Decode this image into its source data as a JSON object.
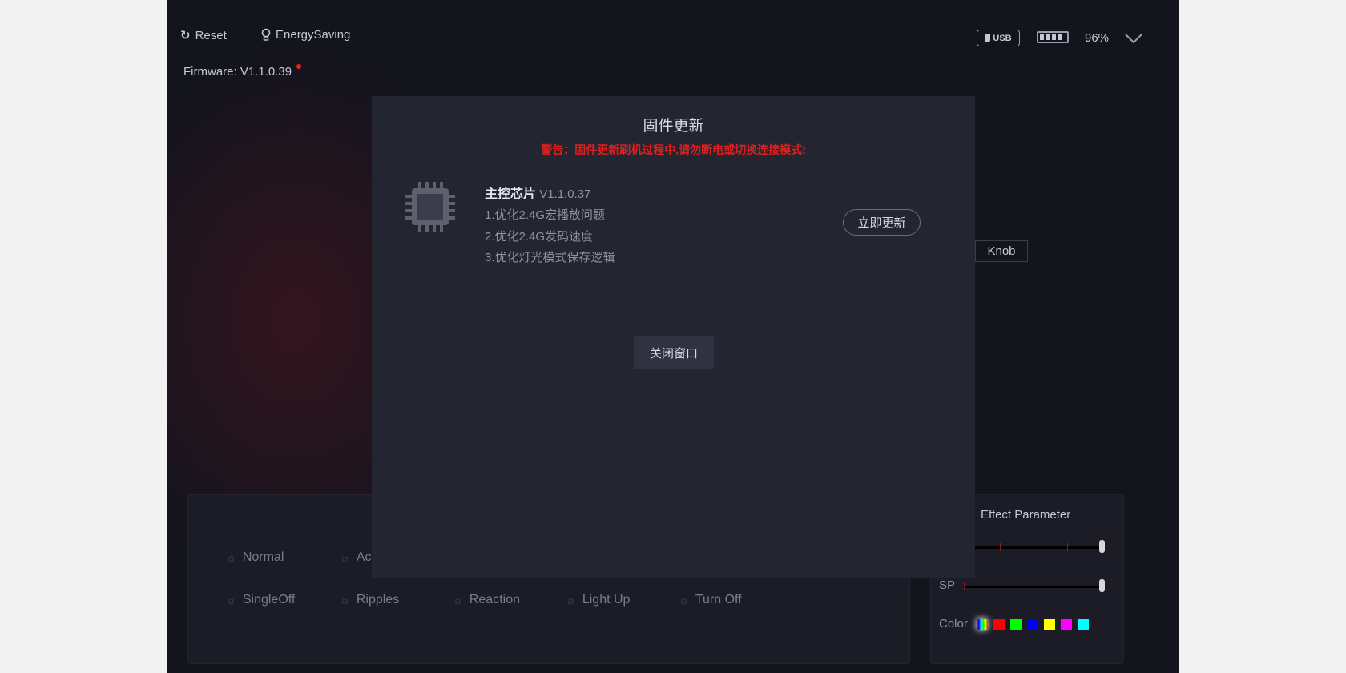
{
  "toolbar": {
    "reset_label": "Reset",
    "energy_label": "EnergySaving",
    "firmware_label": "Firmware: V1.1.0.39"
  },
  "status": {
    "connection": "USB",
    "battery_percent": "96%",
    "battery_level": 0.96
  },
  "knob_tab": "Knob",
  "modes": [
    "Normal",
    "Ac",
    "SingleOff",
    "Ripples",
    "Reaction",
    "Light Up",
    "Turn Off"
  ],
  "effect": {
    "title": "Effect Parameter",
    "sp_label": "SP",
    "color_label": "Color",
    "slider1_value": 1.0,
    "sp_value": 1.0,
    "colors": [
      "#ff0000",
      "#00ff00",
      "#0000ff",
      "#ffff00",
      "#ff00ff",
      "#00ffff"
    ]
  },
  "dialog": {
    "title": "固件更新",
    "warning": "警告：固件更新刷机过程中,请勿断电或切换连接模式!",
    "chip_name": "主控芯片",
    "chip_version": "V1.1.0.37",
    "notes": [
      "1.优化2.4G宏播放问题",
      "2.优化2.4G发码速度",
      "3.优化灯光模式保存逻辑"
    ],
    "update_button": "立即更新",
    "close_button": "关闭窗口"
  },
  "colors": {
    "warning": "#e0201f",
    "accent": "#ff1a1a"
  }
}
